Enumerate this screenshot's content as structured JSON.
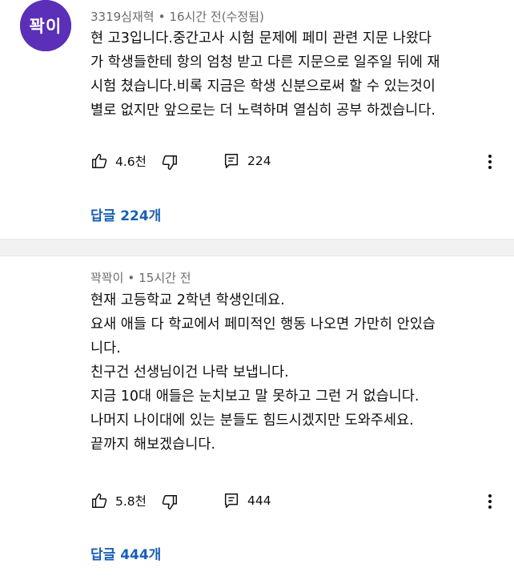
{
  "comments": [
    {
      "author": "3319심재혁",
      "separator": "•",
      "time": "16시간 전(수정됨)",
      "avatar_icon": "default-person-avatar-icon",
      "lines": [
        "현 고3입니다.중간고사 시험 문제에 페미 관련 지문 나왔다",
        "가 학생들한테 항의 엄청 받고 다른 지문으로 일주일 뒤에 재",
        "시험 쳤습니다.비록 지금은 학생 신분으로써 할 수 있는것이",
        "별로 없지만 앞으로는 더 노력하며 열심히 공부 하겠습니다."
      ],
      "likes": "4.6천",
      "reply_count": "224",
      "replies_label": "답글 224개"
    },
    {
      "author": "꽉꽉이",
      "separator": "•",
      "time": "15시간 전",
      "avatar_text": "꽉이",
      "lines": [
        "현재 고등학교 2학년 학생인데요.",
        "요새 애들 다 학교에서 페미적인 행동 나오면 가만히 안있습",
        "니다.",
        "친구건 선생님이건 나락 보냅니다.",
        "지금 10대 애들은 눈치보고 말 못하고 그런 거 없습니다.",
        "나머지 나이대에 있는 분들도 힘드시겠지만 도와주세요.",
        "끝까지 해보겠습니다."
      ],
      "likes": "5.8천",
      "reply_count": "444",
      "replies_label": "답글 444개"
    }
  ],
  "icons": {
    "like": "thumbs-up-icon",
    "dislike": "thumbs-down-icon",
    "reply": "reply-comment-icon",
    "more": "more-vertical-icon"
  },
  "colors": {
    "link": "#1a5fb4",
    "meta": "#6b6b6b",
    "avatar_default": "#2c5ba8",
    "avatar_text_bg": "#5b2fb8",
    "separator": "#f2f2f2"
  }
}
